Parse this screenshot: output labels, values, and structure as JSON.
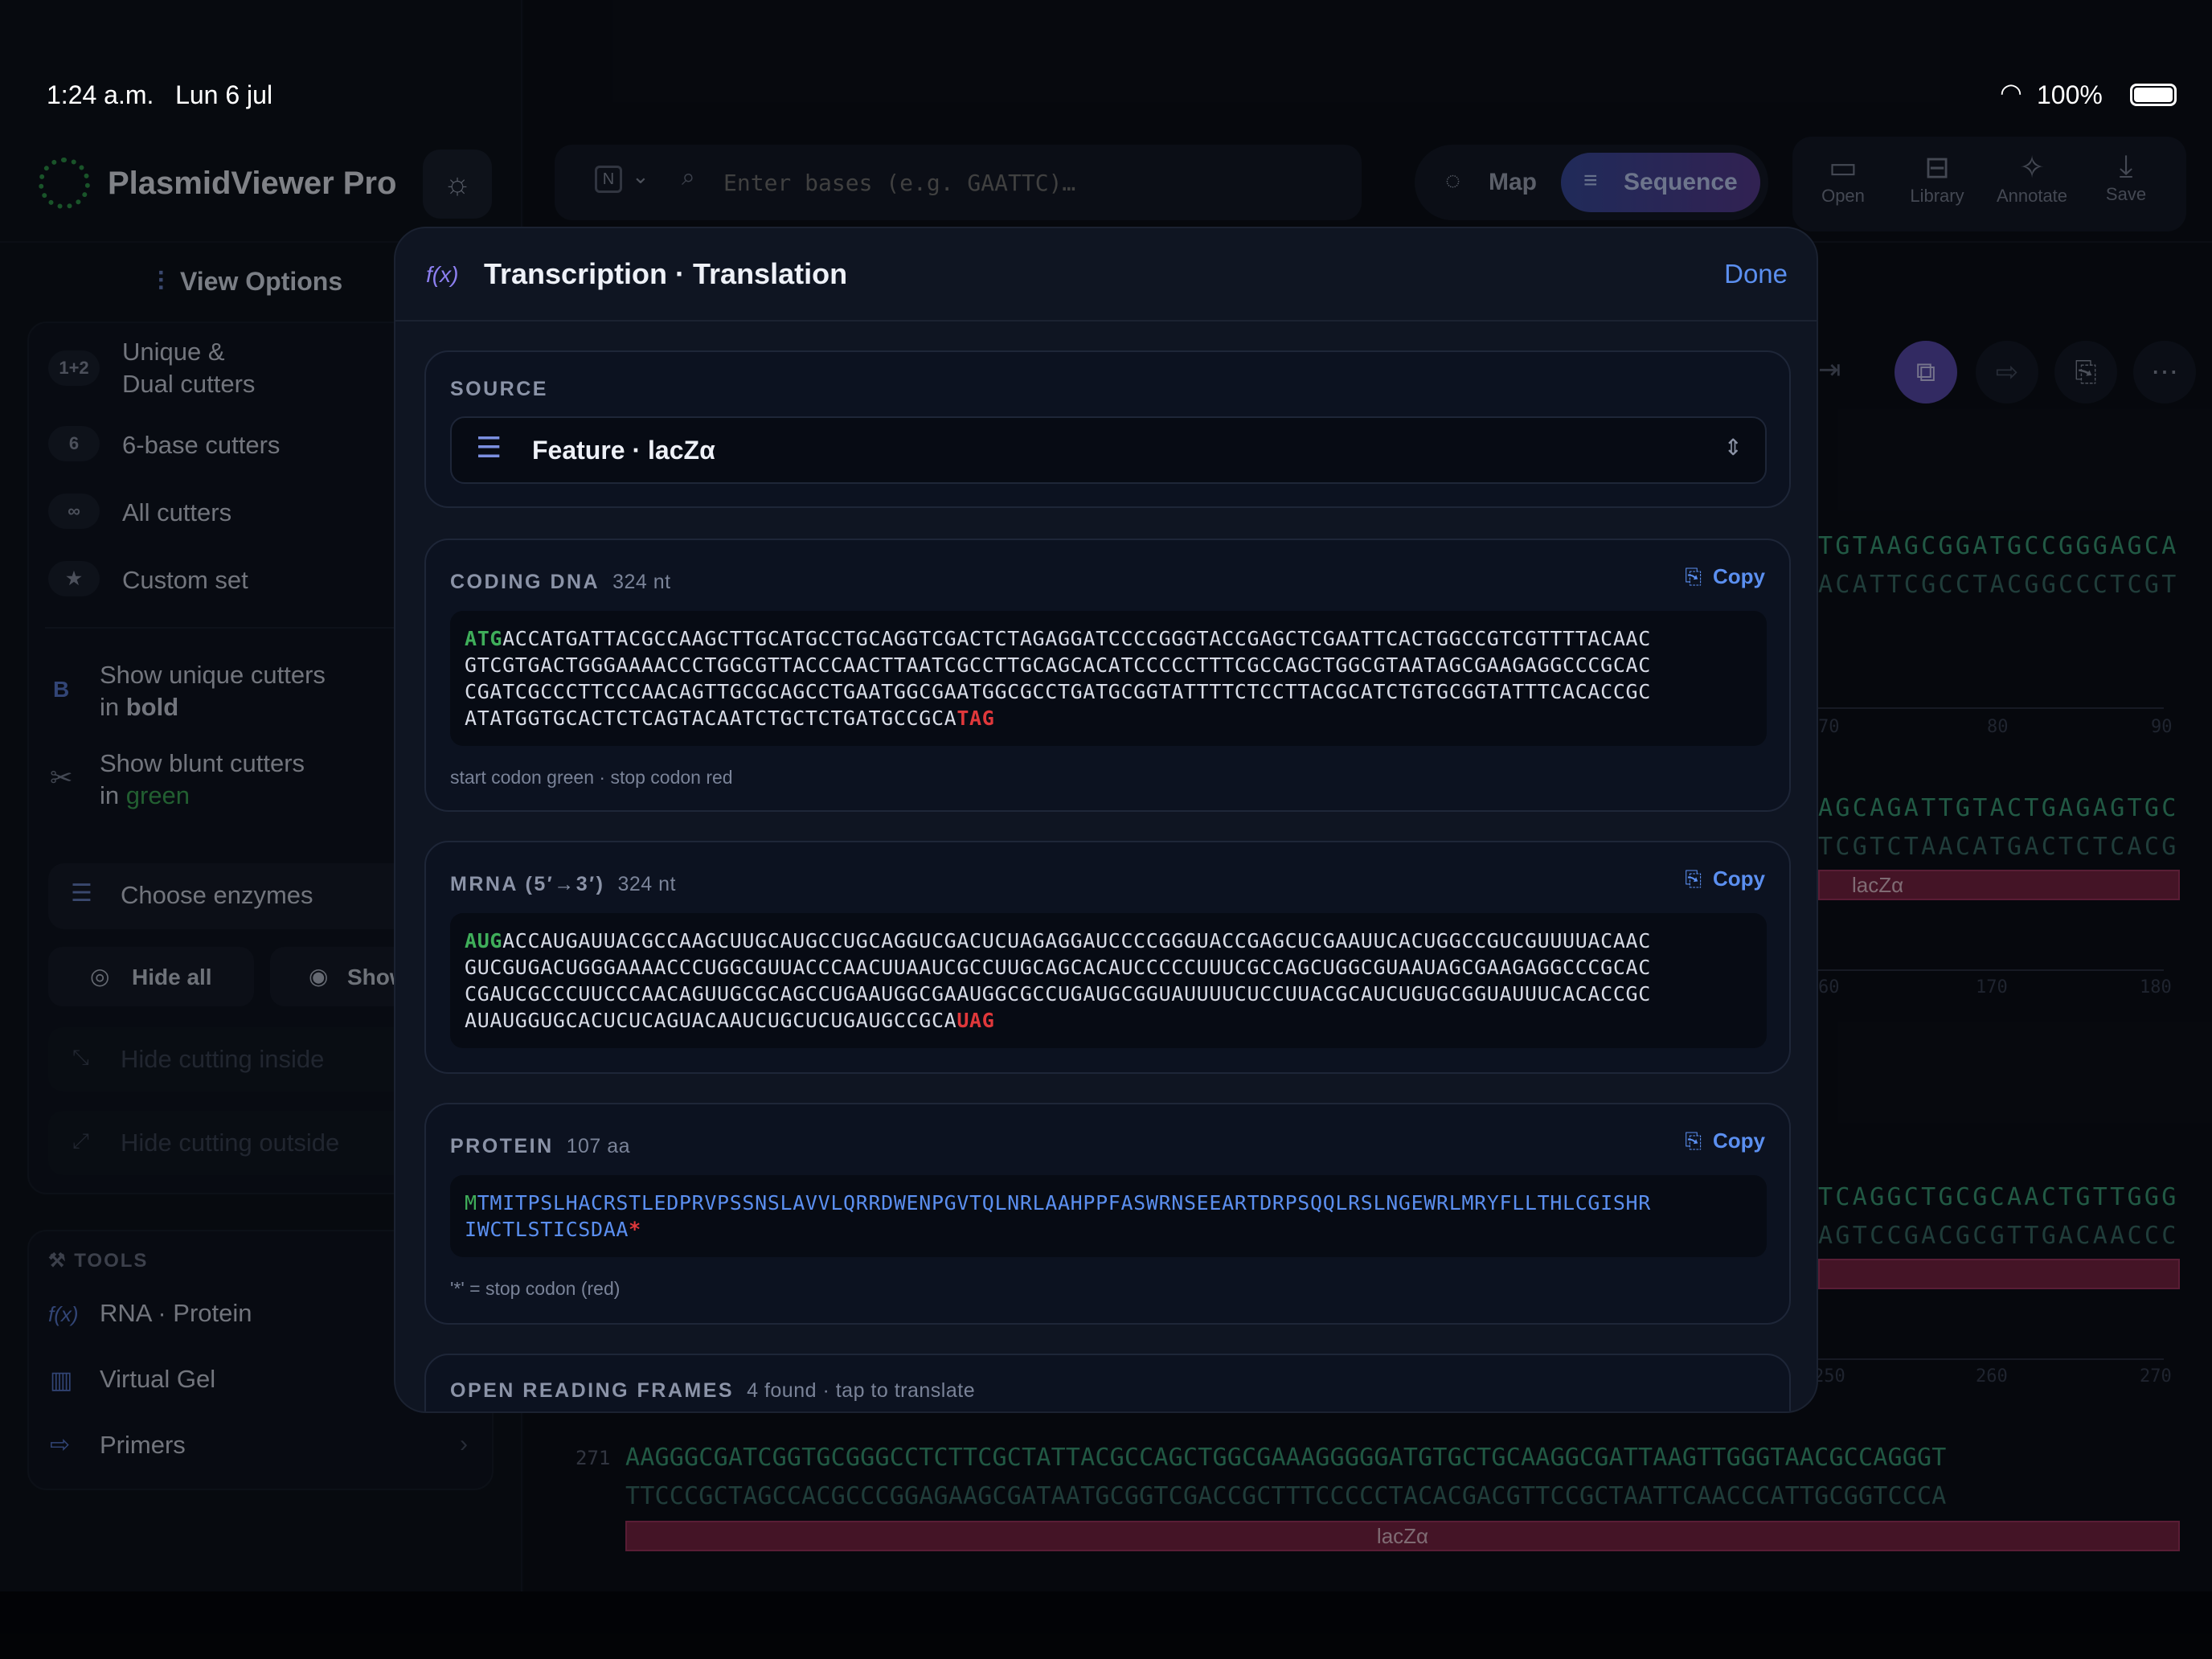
{
  "status": {
    "time": "1:24 a.m.",
    "date": "Lun 6 jul",
    "battery": "100%"
  },
  "app": {
    "name": "PlasmidViewer Pro"
  },
  "search": {
    "mode": "N",
    "placeholder": "Enter bases (e.g. GAATTC)…"
  },
  "view_toggle": {
    "map": "Map",
    "sequence": "Sequence",
    "selected": "Sequence"
  },
  "toolbar": {
    "open": "Open",
    "library": "Library",
    "annotate": "Annotate",
    "save": "Save"
  },
  "sidebar": {
    "view_options": "View Options",
    "cutters": [
      {
        "badge": "1+2",
        "label": "Unique &\nDual cutters"
      },
      {
        "badge": "6",
        "label": "6-base cutters"
      },
      {
        "badge": "∞",
        "label": "All cutters"
      },
      {
        "badge": "★",
        "label": "Custom set"
      }
    ],
    "show_unique_prefix": "Show unique cutters",
    "show_unique_in": "in ",
    "show_unique_style": "bold",
    "show_blunt_prefix": "Show blunt cutters",
    "show_blunt_in": "in ",
    "show_blunt_style": "green",
    "choose_enzymes": "Choose enzymes",
    "hide_all": "Hide all",
    "show_all": "Show all",
    "hide_inside": "Hide cutting inside",
    "hide_outside": "Hide cutting outside",
    "tools_header": "TOOLS",
    "tools": [
      "RNA · Protein",
      "Virtual Gel",
      "Primers"
    ]
  },
  "sequence_view": {
    "rows": [
      {
        "top": "TGTAAGCGGATGCCGGGAGCA",
        "bottom": "ACATTCGCCTACGGCCCTCGT",
        "ticks": [
          "70",
          "80",
          "90"
        ]
      },
      {
        "top": "AGCAGATTGTACTGAGAGTGC",
        "bottom": "TCGTCTAACATGACTCTCACG",
        "feature": "lacZα",
        "ticks": [
          "60",
          "170",
          "180"
        ]
      },
      {
        "top": "TCAGGCTGCGCAACTGTTGGG",
        "bottom": "AGTCCGACGCGTTGACAACCC",
        "ticks": [
          "250",
          "260",
          "270"
        ]
      }
    ],
    "full_row": {
      "index": "271",
      "top": "AAGGGCGATCGGTGCGGGCCTCTTCGCTATTACGCCAGCTGGCGAAAGGGGGATGTGCTGCAAGGCGATTAAGTTGGGTAACGCCAGGGT",
      "bottom": "TTCCCGCTAGCCACGCCCGGAGAAGCGATAATGCGGTCGACCGCTTTCCCCCTACACGACGTTCCGCTAATTCAACCCATTGCGGTCCCA",
      "feature": "lacZα"
    }
  },
  "modal": {
    "title": "Transcription · Translation",
    "done": "Done",
    "source_label": "SOURCE",
    "source_value": "Feature · lacZα",
    "copy": "Copy",
    "coding_dna": {
      "label": "CODING DNA",
      "length": "324 nt",
      "start": "ATG",
      "body": "ACCATGATTACGCCAAGCTTGCATGCCTGCAGGTCGACTCTAGAGGATCCCCGGGTACCGAGCTCGAATTCACTGGCCGTCGTTTTACAAC\nGTCGTGACTGGGAAAACCCTGGCGTTACCCAACTTAATCGCCTTGCAGCACATCCCCCTTTCGCCAGCTGGCGTAATAGCGAAGAGGCCCGCAC\nCGATCGCCCTTCCCAACAGTTGCGCAGCCTGAATGGCGAATGGCGCCTGATGCGGTATTTTCTCCTTACGCATCTGTGCGGTATTTCACACCGC\nATATGGTGCACTCTCAGTACAATCTGCTCTGATGCCGCA",
      "stop": "TAG",
      "note": "start codon green · stop codon red"
    },
    "mrna": {
      "label": "MRNA (5′→3′)",
      "length": "324 nt",
      "start": "AUG",
      "body": "ACCAUGAUUACGCCAAGCUUGCAUGCCUGCAGGUCGACUCUAGAGGAUCCCCGGGUACCGAGCUCGAAUUCACUGGCCGUCGUUUUACAAC\nGUCGUGACUGGGAAAACCCUGGCGUUACCCAACUUAAUCGCCUUGCAGCACAUCCCCCUUUCGCCAGCUGGCGUAAUAGCGAAGAGGCCCGCAC\nCGAUCGCCCUUCCCAACAGUUGCGCAGCCUGAAUGGCGAAUGGCGCCUGAUGCGGUAUUUUCUCCUUACGCAUCUGUGCGGUAUUUCACACCGC\nAUAUGGUGCACUCUCAGUACAAUCUGCUCUGAUGCCGCA",
      "stop": "UAG"
    },
    "protein": {
      "label": "PROTEIN",
      "length": "107 aa",
      "start": "M",
      "body": "TMITPSLHACRSTLEDPRVPSSNSLAVVLQRRDWENPGVTQLNRLAAHPPFASWRNSEEARTDRPSQQLRSLNGEWRLMRYFLLTHLCGISHR\nIWCTLSTICSDAA",
      "stop": "*",
      "note": "'*' = stop codon (red)"
    },
    "orf": {
      "label": "OPEN READING FRAMES",
      "sub": "4 found · tap to translate"
    }
  },
  "colors": {
    "accent": "#5b8ff0",
    "start_codon": "#3fae5a",
    "stop_codon": "#e0383b",
    "feature": "#7c2546",
    "sequence_toggle": "#4a4fa8"
  }
}
